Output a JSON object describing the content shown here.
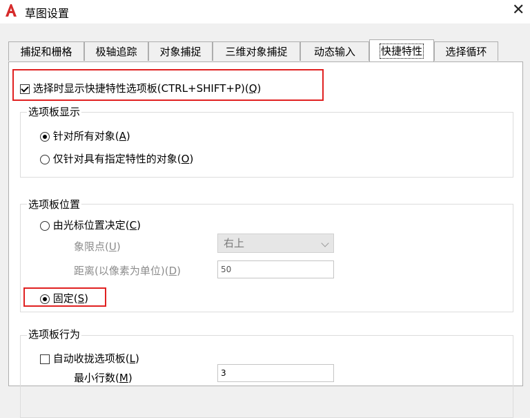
{
  "window": {
    "title": "草图设置",
    "close_glyph": "✕"
  },
  "tabs": [
    {
      "label": "捕捉和栅格"
    },
    {
      "label": "极轴追踪"
    },
    {
      "label": "对象捕捉"
    },
    {
      "label": "三维对象捕捉"
    },
    {
      "label": "动态输入"
    },
    {
      "label": "快捷特性"
    },
    {
      "label": "选择循环"
    }
  ],
  "main": {
    "show_palette": {
      "label": "选择时显示快捷特性选项板(CTRL+SHIFT+P)(",
      "key": "Q",
      "suffix": ")",
      "checked": true
    },
    "palette_display": {
      "label": "选项板显示",
      "opt_all": {
        "label": "针对所有对象(",
        "key": "A",
        "suffix": ")",
        "checked": true
      },
      "opt_specific": {
        "label": "仅针对具有指定特性的对象(",
        "key": "O",
        "suffix": ")",
        "checked": false
      }
    },
    "palette_location": {
      "label": "选项板位置",
      "opt_cursor": {
        "label": "由光标位置决定(",
        "key": "C",
        "suffix": ")",
        "checked": false
      },
      "quadrant_label": "象限点(",
      "quadrant_key": "U",
      "quadrant_suffix": ")",
      "quadrant_value": "右上",
      "distance_label": "距离(以像素为单位)(",
      "distance_key": "D",
      "distance_suffix": ")",
      "distance_value": "50",
      "opt_static": {
        "label": "固定(",
        "key": "S",
        "suffix": ")",
        "checked": true
      }
    },
    "palette_behavior": {
      "label": "选项板行为",
      "auto_collapse": {
        "label": "自动收拢选项板(",
        "key": "L",
        "suffix": ")",
        "checked": false
      },
      "min_rows_label": "最小行数(",
      "min_rows_key": "M",
      "min_rows_suffix": ")",
      "min_rows_value": "3"
    }
  },
  "colors": {
    "highlight": "#e02020",
    "app_icon": "#d62b2b"
  },
  "icons": {
    "app": "autocad-a-icon",
    "close": "close-icon"
  }
}
